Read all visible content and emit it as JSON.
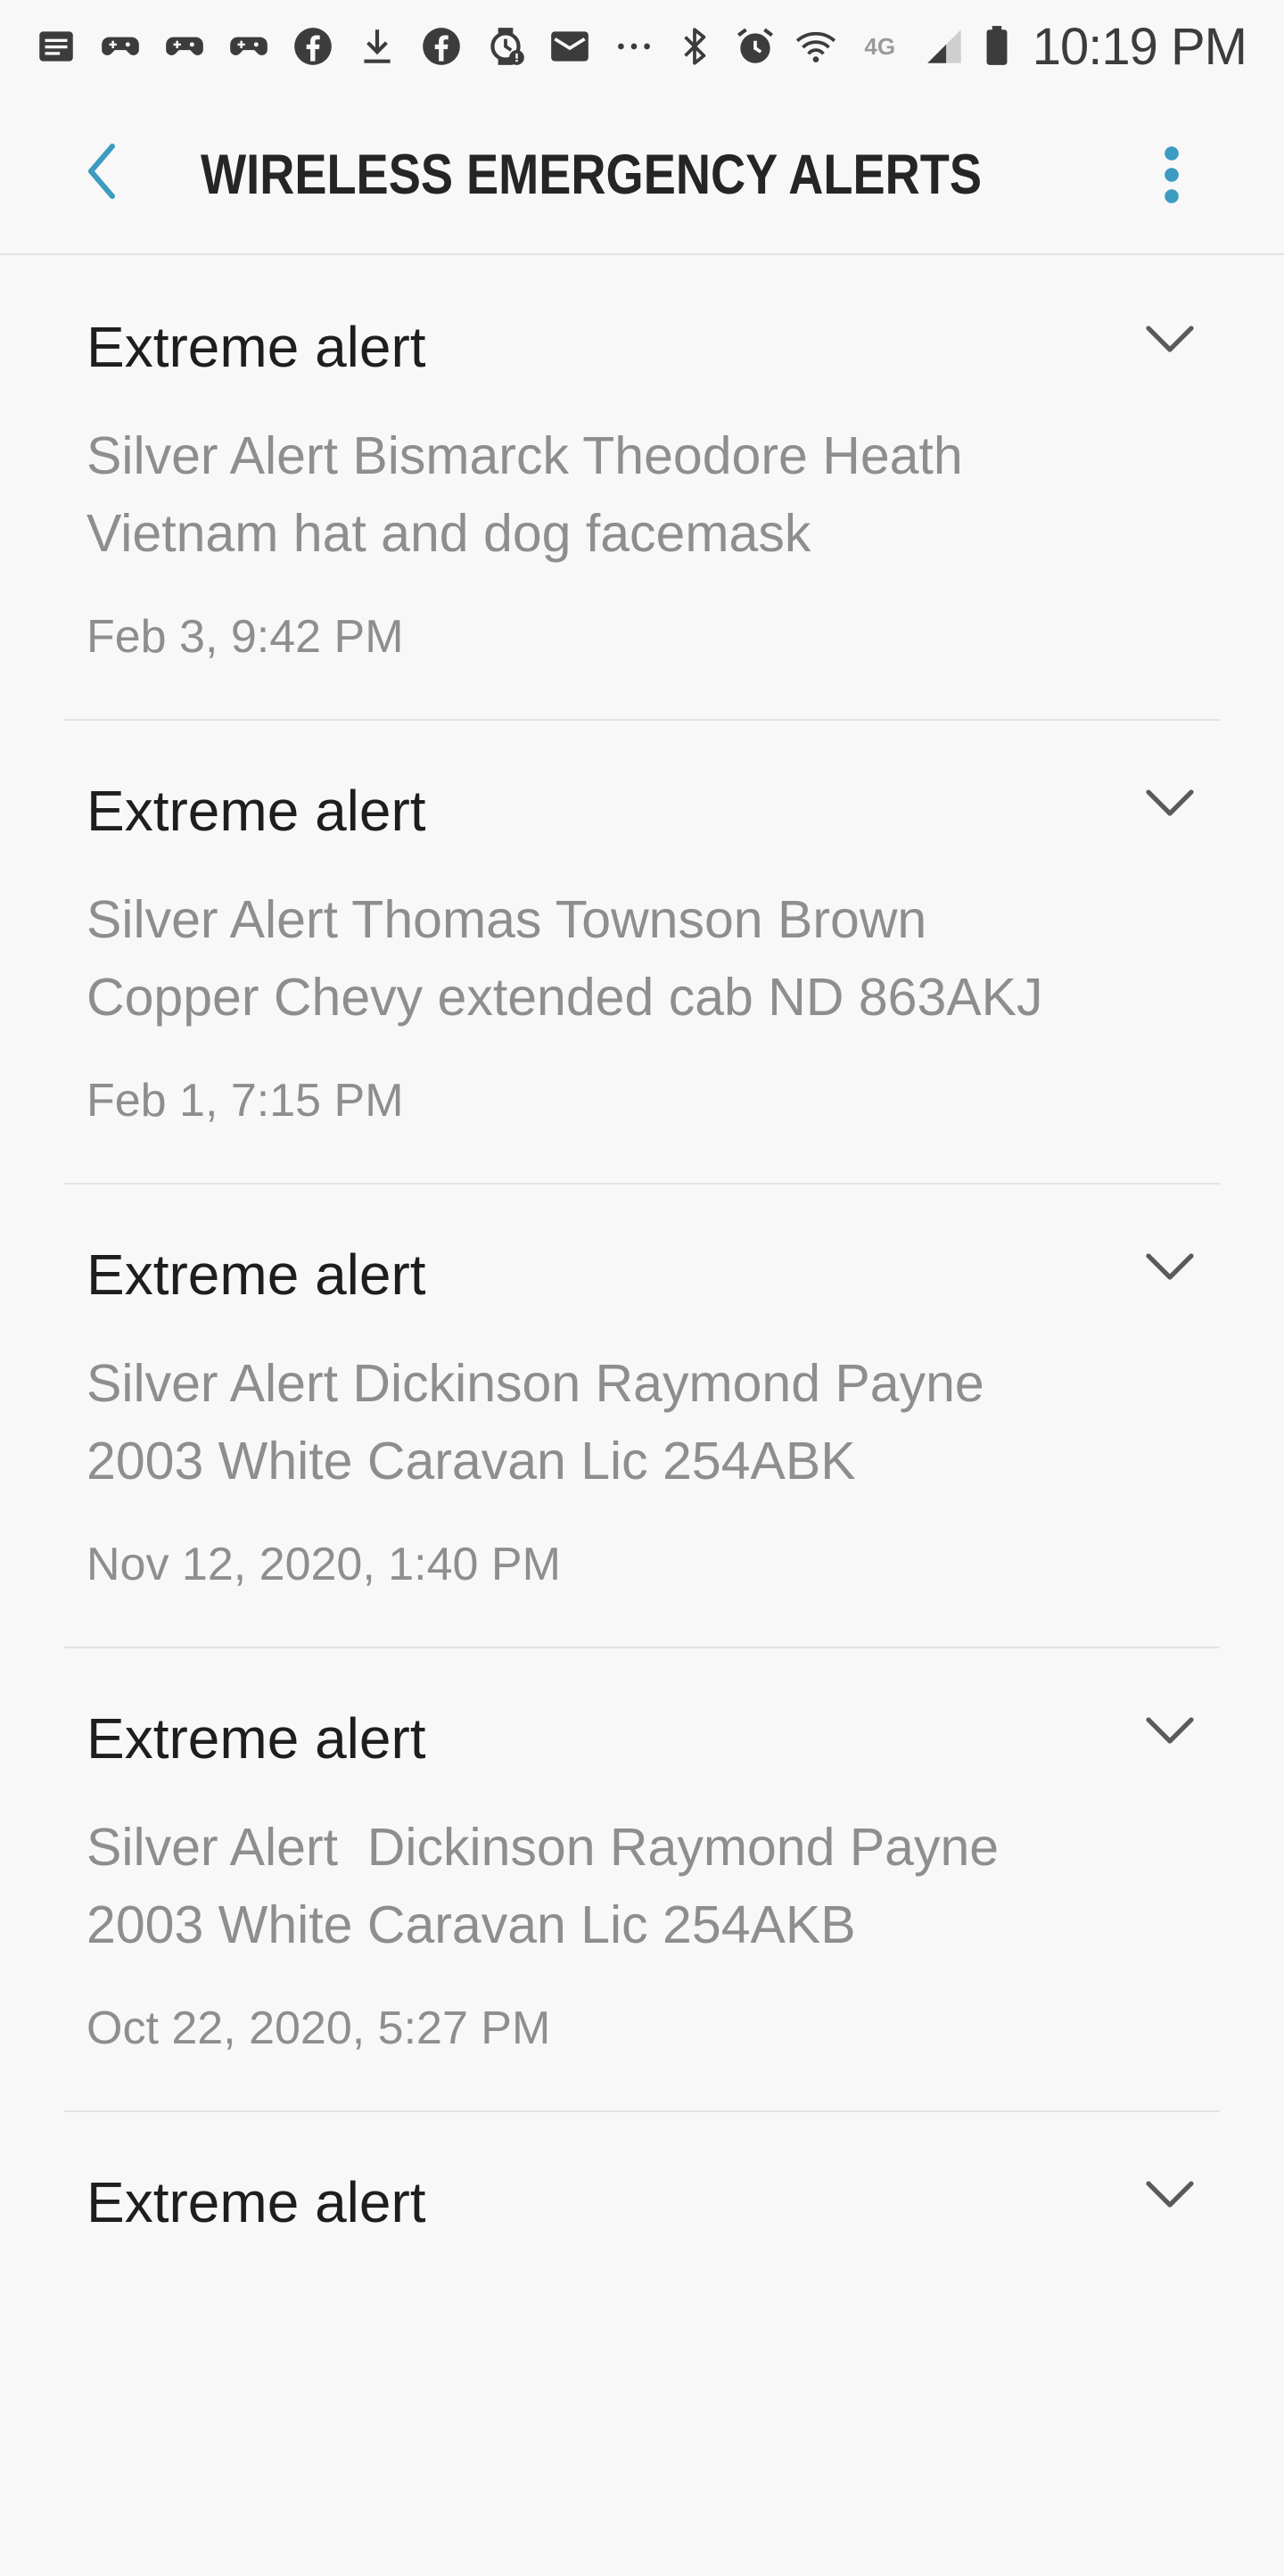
{
  "status_bar": {
    "time": "10:19 PM",
    "network_label": "4G",
    "left_icons": [
      "notes-icon",
      "game-controller-icon",
      "game-controller-icon",
      "game-controller-icon",
      "facebook-icon",
      "download-icon",
      "facebook-icon",
      "watch-alert-icon",
      "mail-icon",
      "more-dots-icon"
    ],
    "right_icons": [
      "bluetooth-icon",
      "alarm-icon",
      "wifi-icon",
      "signal-icon",
      "battery-icon"
    ]
  },
  "app_bar": {
    "title": "WIRELESS EMERGENCY ALERTS",
    "back_icon": "chevron-left-icon",
    "more_icon": "more-vertical-icon",
    "accent_color": "#3d9bc1"
  },
  "alerts": [
    {
      "title": "Extreme alert",
      "message": "Silver Alert Bismarck Theodore Heath\nVietnam hat and dog facemask",
      "date": "Feb 3, 9:42 PM"
    },
    {
      "title": "Extreme alert",
      "message": "Silver Alert Thomas Townson Brown\nCopper Chevy extended cab ND 863AKJ",
      "date": "Feb 1, 7:15 PM"
    },
    {
      "title": "Extreme alert",
      "message": "Silver Alert Dickinson Raymond Payne\n2003 White Caravan Lic 254ABK",
      "date": "Nov 12, 2020, 1:40 PM"
    },
    {
      "title": "Extreme alert",
      "message": "Silver Alert  Dickinson Raymond Payne\n2003 White Caravan Lic 254AKB",
      "date": "Oct 22, 2020, 5:27 PM"
    },
    {
      "title": "Extreme alert",
      "message": "",
      "date": ""
    }
  ]
}
